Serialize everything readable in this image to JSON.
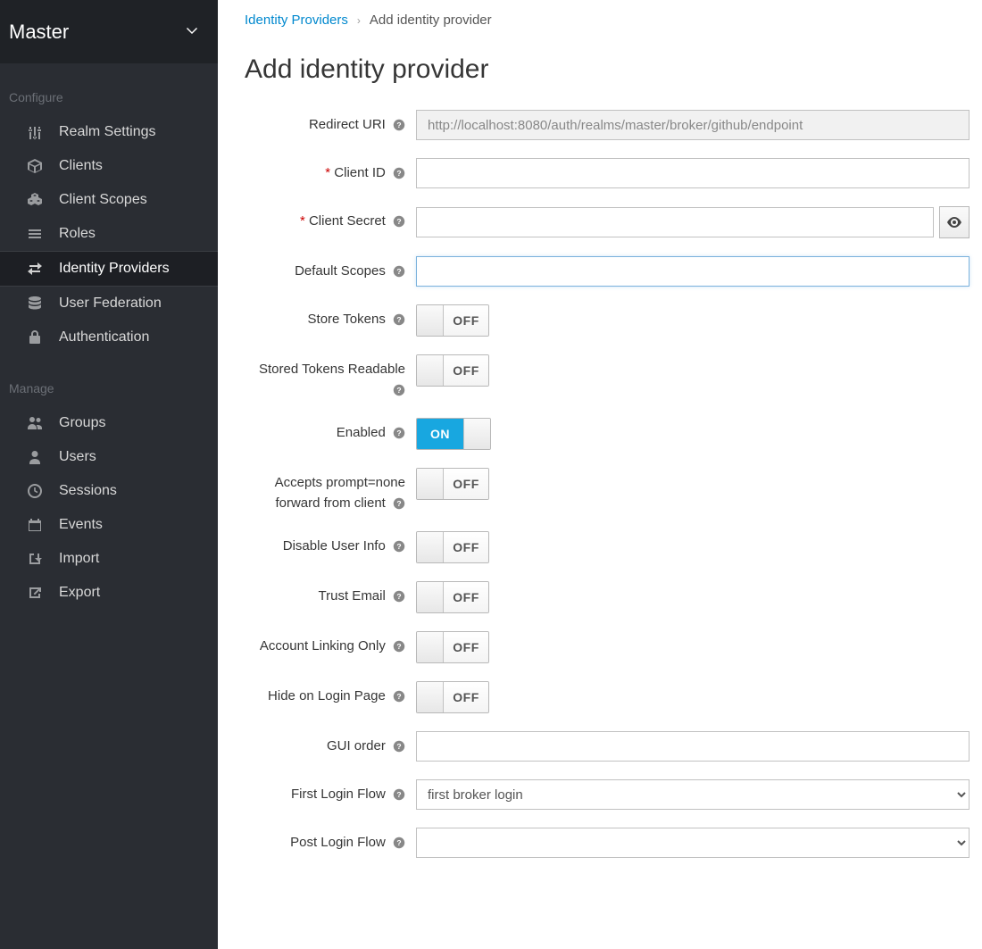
{
  "sidebar": {
    "realm": "Master",
    "sections": [
      {
        "title": "Configure",
        "items": [
          {
            "icon": "sliders",
            "label": "Realm Settings"
          },
          {
            "icon": "cube",
            "label": "Clients"
          },
          {
            "icon": "cubes",
            "label": "Client Scopes"
          },
          {
            "icon": "list",
            "label": "Roles"
          },
          {
            "icon": "exchange",
            "label": "Identity Providers",
            "active": true
          },
          {
            "icon": "database",
            "label": "User Federation"
          },
          {
            "icon": "lock",
            "label": "Authentication"
          }
        ]
      },
      {
        "title": "Manage",
        "items": [
          {
            "icon": "users",
            "label": "Groups"
          },
          {
            "icon": "user",
            "label": "Users"
          },
          {
            "icon": "clock",
            "label": "Sessions"
          },
          {
            "icon": "calendar",
            "label": "Events"
          },
          {
            "icon": "import",
            "label": "Import"
          },
          {
            "icon": "export",
            "label": "Export"
          }
        ]
      }
    ]
  },
  "breadcrumb": {
    "parent": "Identity Providers",
    "current": "Add identity provider"
  },
  "page": {
    "title": "Add identity provider"
  },
  "toggleText": {
    "on": "ON",
    "off": "OFF"
  },
  "form": {
    "redirectUri": {
      "label": "Redirect URI",
      "value": "http://localhost:8080/auth/realms/master/broker/github/endpoint"
    },
    "clientId": {
      "label": "Client ID",
      "required": true,
      "value": ""
    },
    "clientSecret": {
      "label": "Client Secret",
      "required": true,
      "value": ""
    },
    "defaultScopes": {
      "label": "Default Scopes",
      "value": ""
    },
    "storeTokens": {
      "label": "Store Tokens",
      "value": false
    },
    "storedTokensReadable": {
      "label": "Stored Tokens Readable",
      "value": false
    },
    "enabled": {
      "label": "Enabled",
      "value": true
    },
    "acceptsPromptNone": {
      "label": "Accepts prompt=none forward from client",
      "value": false
    },
    "disableUserInfo": {
      "label": "Disable User Info",
      "value": false
    },
    "trustEmail": {
      "label": "Trust Email",
      "value": false
    },
    "accountLinkingOnly": {
      "label": "Account Linking Only",
      "value": false
    },
    "hideOnLoginPage": {
      "label": "Hide on Login Page",
      "value": false
    },
    "guiOrder": {
      "label": "GUI order",
      "value": ""
    },
    "firstLoginFlow": {
      "label": "First Login Flow",
      "value": "first broker login"
    },
    "postLoginFlow": {
      "label": "Post Login Flow",
      "value": ""
    }
  }
}
